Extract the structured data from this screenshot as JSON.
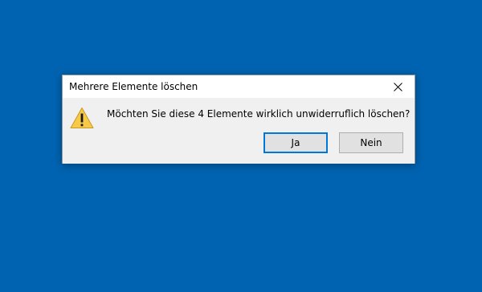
{
  "dialog": {
    "title": "Mehrere Elemente löschen",
    "message": "Möchten Sie diese 4 Elemente wirklich unwiderruflich löschen?",
    "icon": "warning-icon",
    "close_icon": "close-icon",
    "buttons": {
      "yes_label": "Ja",
      "no_label": "Nein"
    }
  },
  "colors": {
    "desktop": "#0063b1",
    "dialog_bg": "#f0f0f0",
    "titlebar_bg": "#ffffff",
    "default_button_border": "#0078d7",
    "warning_fill": "#f7c948"
  }
}
